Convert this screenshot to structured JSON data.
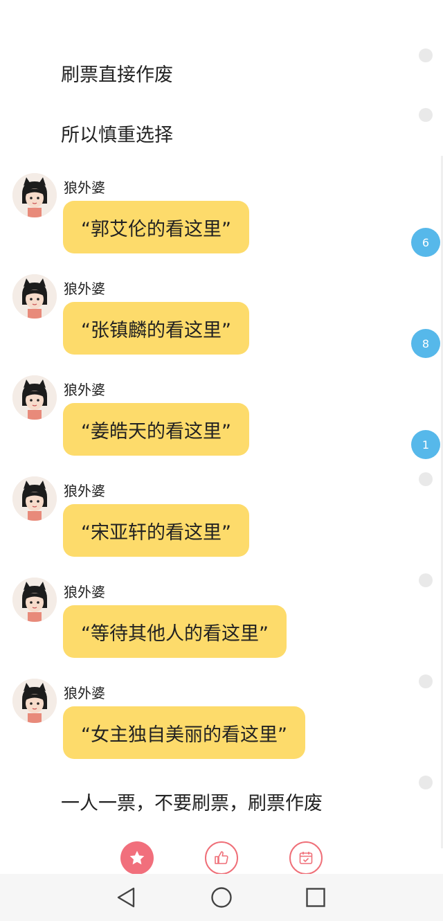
{
  "article": {
    "line_1": "刷票直接作废",
    "line_2": "所以慎重选择",
    "footer_line": "一人一票，不要刷票，刷票作废"
  },
  "messages": [
    {
      "sender": "狼外婆",
      "text": "“郭艾伦的看这里”"
    },
    {
      "sender": "狼外婆",
      "text": "“张镇麟的看这里”"
    },
    {
      "sender": "狼外婆",
      "text": "“姜皓天的看这里”"
    },
    {
      "sender": "狼外婆",
      "text": "“宋亚轩的看这里”"
    },
    {
      "sender": "狼外婆",
      "text": "“等待其他人的看这里”"
    },
    {
      "sender": "狼外婆",
      "text": "“女主独自美丽的看这里”"
    }
  ],
  "comment_badges": [
    {
      "count": "6"
    },
    {
      "count": "8"
    },
    {
      "count": "1"
    }
  ],
  "actions": {
    "favorite_icon": "star-icon",
    "like_icon": "thumbs-up-icon",
    "share_icon": "calendar-check-icon"
  },
  "navbar": {
    "back_icon": "triangle-back-icon",
    "home_icon": "circle-home-icon",
    "recents_icon": "square-recents-icon"
  },
  "colors": {
    "bubble": "#fddb6b",
    "badge": "#56b8ea",
    "favorite_bg": "#f16f7c",
    "outline_red": "#ef6f78"
  }
}
